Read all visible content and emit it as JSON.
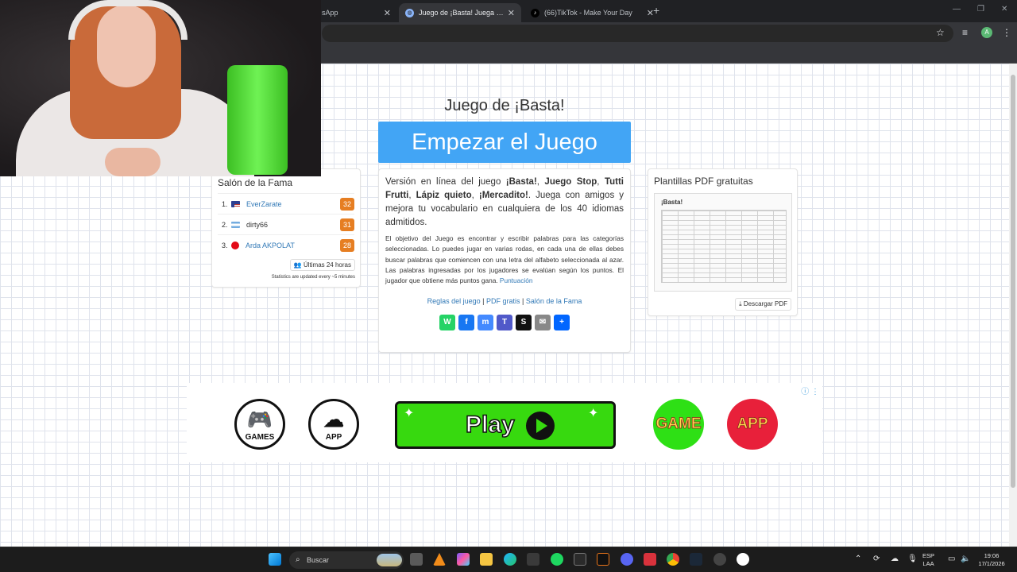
{
  "browser": {
    "tabs": [
      {
        "title": "sApp",
        "favicon": "whatsapp-icon",
        "active": false
      },
      {
        "title": "Juego de ¡Basta! Juega Stop, Tu",
        "favicon": "globe-icon",
        "active": true
      },
      {
        "title": "(66)TikTok - Make Your Day",
        "favicon": "tiktok-icon",
        "active": false
      }
    ],
    "profile_initial": "A"
  },
  "page": {
    "title": "Juego de ¡Basta!",
    "start_button": "Empezar el Juego",
    "hall_of_fame": {
      "title": "Salón de la Fama",
      "entries": [
        {
          "rank": "1.",
          "name": "EverZarate",
          "score": "32",
          "flag": "us-flag"
        },
        {
          "rank": "2.",
          "name": "dirty66",
          "score": "31",
          "flag": "ar-flag"
        },
        {
          "rank": "3.",
          "name": "Arda AKPOLAT",
          "score": "28",
          "flag": "tr-flag"
        }
      ],
      "period_button": "Últimas 24 horas",
      "stats_note": "Statistics are updated every ~5 minutes"
    },
    "intro": {
      "t1": "Versión en línea del juego ",
      "b1": "¡Basta!",
      "t2": ", ",
      "b2": "Juego Stop",
      "t3": ", ",
      "b3": "Tutti Frutti",
      "t4": ", ",
      "b4": "Lápiz quieto",
      "t5": ", ",
      "b5": "¡Mercadito!",
      "t6": ". Juega con amigos y mejora tu vocabulario en cualquiera de los 40 idiomas admitidos."
    },
    "description": "El objetivo del Juego es encontrar y escribir palabras para las categorías seleccionadas. Lo puedes jugar en varias rodas, en cada una de ellas debes buscar palabras que comiencen con una letra del alfabeto seleccionada al azar. Las palabras ingresadas por los jugadores se evalúan según los puntos. El jugador que obtiene más puntos gana. ",
    "score_link": "Puntuación",
    "links": {
      "rules": "Reglas del juego",
      "sep": " | ",
      "pdf": "PDF gratis",
      "fame": "Salón de la Fama"
    },
    "share": [
      {
        "name": "whatsapp-share-icon",
        "color": "#25d366",
        "glyph": "W"
      },
      {
        "name": "facebook-share-icon",
        "color": "#1877f2",
        "glyph": "f"
      },
      {
        "name": "messenger-share-icon",
        "color": "#448aff",
        "glyph": "m"
      },
      {
        "name": "teams-share-icon",
        "color": "#5059c9",
        "glyph": "T"
      },
      {
        "name": "snapchat-share-icon",
        "color": "#111111",
        "glyph": "S"
      },
      {
        "name": "email-share-icon",
        "color": "#888888",
        "glyph": "✉"
      },
      {
        "name": "share-plus-icon",
        "color": "#0166ff",
        "glyph": "+"
      }
    ],
    "pdf": {
      "title": "Plantillas PDF gratuitas",
      "thumb_title": "¡Basta!",
      "download_button": "Descargar PDF"
    },
    "ad": {
      "games_label": "GAMES",
      "app_label": "APP",
      "play_label": "Play",
      "game_label": "GAME",
      "app2_label": "APP"
    }
  },
  "taskbar": {
    "search_placeholder": "Buscar",
    "lang_top": "ESP",
    "lang_bottom": "LAA",
    "time": "19:06",
    "date": "17/1/2026"
  }
}
